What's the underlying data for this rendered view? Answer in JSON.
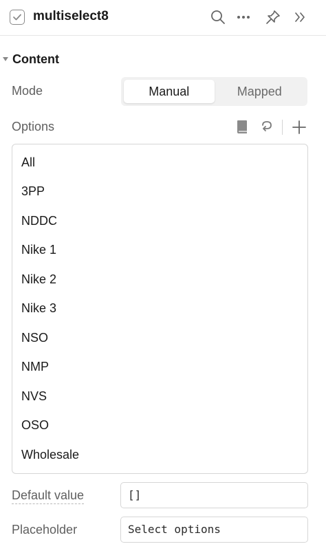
{
  "header": {
    "title": "multiselect8",
    "icons": [
      "checkbox-icon",
      "search-icon",
      "more-icon",
      "pin-icon",
      "expand-icon"
    ]
  },
  "section": {
    "title": "Content"
  },
  "mode": {
    "label": "Mode",
    "options": [
      "Manual",
      "Mapped"
    ],
    "selected": "Manual"
  },
  "options": {
    "label": "Options",
    "items": [
      "All",
      "3PP",
      "NDDC",
      "Nike 1",
      "Nike 2",
      "Nike 3",
      "NSO",
      "NMP",
      "NVS",
      "OSO",
      "Wholesale"
    ]
  },
  "default_value": {
    "label": "Default value",
    "value": "[]"
  },
  "placeholder": {
    "label": "Placeholder",
    "value": "Select options"
  }
}
